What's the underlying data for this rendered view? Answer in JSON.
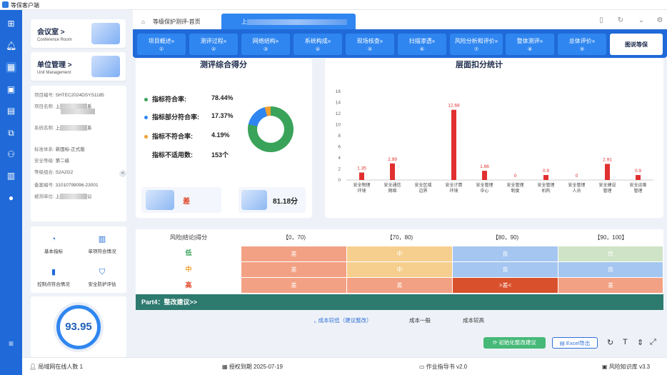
{
  "app_title": "等保客户端",
  "sidebar_cards": [
    {
      "title": "会议室 >",
      "subtitle": "Conference Room"
    },
    {
      "title": "单位管理 >",
      "subtitle": "Unit Management"
    }
  ],
  "project_info": [
    {
      "label": "项目编号:",
      "value": "SHTEC2024DSYS1185"
    },
    {
      "label": "项目名称:",
      "value": "上",
      "value2": "系"
    },
    {
      "label": "系统名称:",
      "value": "上",
      "value2": "系"
    },
    {
      "label": "标准体系:",
      "value": "新国标-正式版"
    },
    {
      "label": "安全等级:",
      "value": "第二级"
    },
    {
      "label": "等级组合:",
      "value": "S2A2G2"
    },
    {
      "label": "备案编号:",
      "value": "31010799096-23001"
    },
    {
      "label": "被测单位:",
      "value": "上",
      "value2": "公"
    }
  ],
  "tools": [
    "基本指标",
    "单项符合情况",
    "控制点符合情况",
    "安全防护评估"
  ],
  "total_score": "93.95",
  "tabs": {
    "home": "等级保护测评-首页",
    "active": "上"
  },
  "steps": [
    {
      "label": "项目概述»",
      "num": "①"
    },
    {
      "label": "测评过程»",
      "num": "②"
    },
    {
      "label": "网络结构»",
      "num": "③"
    },
    {
      "label": "系统构成»",
      "num": "④"
    },
    {
      "label": "现场核查»",
      "num": "⑤"
    },
    {
      "label": "扫描渗透»",
      "num": "⑥"
    },
    {
      "label": "风险分析和评价»",
      "num": "⑦"
    },
    {
      "label": "整体测评»",
      "num": "⑧"
    },
    {
      "label": "总体评价»",
      "num": "⑨"
    },
    {
      "label": "图说等保",
      "num": ""
    }
  ],
  "score_panel": {
    "title": "测评综合得分",
    "rows": [
      {
        "label": "指标符合率:",
        "value": "78.44%",
        "color": "#3aa35a"
      },
      {
        "label": "指标部分符合率:",
        "value": "17.37%",
        "color": "#2f86f0"
      },
      {
        "label": "指标不符合率:",
        "value": "4.19%",
        "color": "#f0a030"
      },
      {
        "label": "指标不适用数:",
        "value": "153个",
        "color": ""
      }
    ],
    "grade": "差",
    "grade_score": "81.18分"
  },
  "chart_data": {
    "type": "bar",
    "title": "层面扣分统计",
    "categories": [
      "安全物理环境",
      "安全通信网络",
      "安全区域边界",
      "安全计算环境",
      "安全管理中心",
      "安全管理制度",
      "安全管理机构",
      "安全管理人员",
      "安全建设管理",
      "安全运维管理"
    ],
    "values": [
      1.35,
      2.99,
      0,
      12.68,
      1.66,
      0,
      0.9,
      0,
      2.91,
      0.9
    ],
    "value_labels": [
      "1.35",
      "2.99",
      "",
      "12.68",
      "1.66",
      "0",
      "0.9",
      "0",
      "2.91",
      "0.9"
    ],
    "yticks": [
      "0",
      "2",
      "4",
      "6",
      "8",
      "10",
      "12",
      "14",
      "16"
    ],
    "ylim": [
      0,
      16
    ],
    "bar_color": "#e03030"
  },
  "risk_table": {
    "header": [
      "风险|结论|得分",
      "【0，70)",
      "【70，80)",
      "【80，90)",
      "【90，100】"
    ],
    "rows": [
      {
        "level": "低",
        "level_color": "#3aa35a",
        "cells": [
          "差",
          "中",
          "良",
          "优"
        ]
      },
      {
        "level": "中",
        "level_color": "#f0a030",
        "cells": [
          "差",
          "中",
          "良",
          "良"
        ]
      },
      {
        "level": "高",
        "level_color": "#e04020",
        "cells": [
          "差",
          "差",
          ">差<",
          "差"
        ]
      }
    ]
  },
  "part4": "Part4：整改建议>>",
  "cost_tabs": [
    "成本较低（建议整改）",
    "成本一般",
    "成本较高"
  ],
  "buttons": {
    "init": "初始化整改建议",
    "excel": "Excel导出"
  },
  "footer": {
    "online": "局域网在线人数 1",
    "license": "授权到期 2025-07-19",
    "guide": "作业指导书 v2.0",
    "risk_lib": "风险知识库 v3.3"
  }
}
